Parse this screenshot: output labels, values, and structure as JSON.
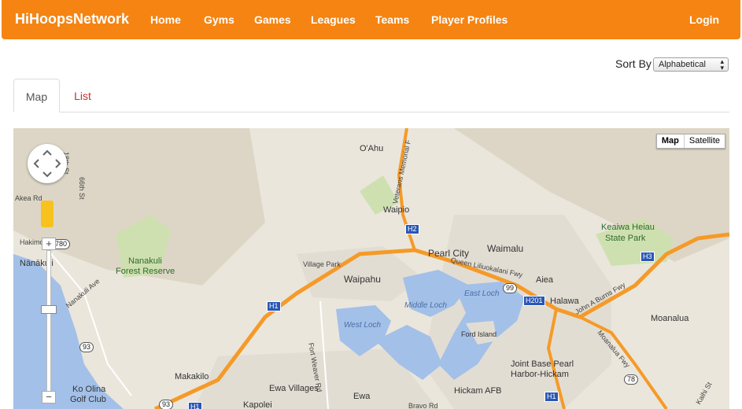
{
  "header": {
    "brand": "HiHoopsNetwork",
    "nav": [
      {
        "label": "Home"
      },
      {
        "label": "Gyms"
      },
      {
        "label": "Games"
      },
      {
        "label": "Leagues"
      },
      {
        "label": "Teams"
      },
      {
        "label": "Player Profiles"
      }
    ],
    "login": "Login",
    "color": "#f58412"
  },
  "sort": {
    "label": "Sort By",
    "selected": "Alphabetical"
  },
  "tabs": [
    {
      "label": "Map",
      "active": true
    },
    {
      "label": "List",
      "active": false
    }
  ],
  "map": {
    "type_controls": [
      "Map",
      "Satellite"
    ],
    "zoom_in": "+",
    "zoom_out": "−",
    "labels": [
      {
        "text": "O'Ahu"
      },
      {
        "text": "Veterans Memorial F"
      },
      {
        "text": "Waipio"
      },
      {
        "text": "Pearl City"
      },
      {
        "text": "Waimalu"
      },
      {
        "text": "Aiea"
      },
      {
        "text": "Halawa"
      },
      {
        "text": "Keaiwa Heiau"
      },
      {
        "text": "State Park"
      },
      {
        "text": "Nanakuli"
      },
      {
        "text": "Forest Reserve"
      },
      {
        "text": "Village Park"
      },
      {
        "text": "Waipahu"
      },
      {
        "text": "Queen Liliuokalani Fwy"
      },
      {
        "text": "Middle Loch"
      },
      {
        "text": "East Loch"
      },
      {
        "text": "West Loch"
      },
      {
        "text": "Ford Island"
      },
      {
        "text": "Joint Base Pearl"
      },
      {
        "text": "Harbor-Hickam"
      },
      {
        "text": "Hickam AFB"
      },
      {
        "text": "Moanalua"
      },
      {
        "text": "Moanalua Fwy"
      },
      {
        "text": "John A Burns Fwy"
      },
      {
        "text": "Makakilo"
      },
      {
        "text": "Ewa Villages"
      },
      {
        "text": "Ewa"
      },
      {
        "text": "Kapolei"
      },
      {
        "text": "Ko Olina"
      },
      {
        "text": "Golf Club"
      },
      {
        "text": "Nānākuli"
      },
      {
        "text": "Hakimo Rd"
      },
      {
        "text": "Nanakuli Ave"
      },
      {
        "text": "Fort Weaver Rd"
      },
      {
        "text": "Bravo Rd"
      },
      {
        "text": "18th St"
      },
      {
        "text": "66th St"
      },
      {
        "text": "Kaihi St"
      },
      {
        "text": "Akea Rd"
      }
    ],
    "shields": [
      "780",
      "93",
      "93",
      "99",
      "78",
      "H1",
      "H1",
      "H1",
      "H2",
      "H3",
      "H201"
    ]
  }
}
